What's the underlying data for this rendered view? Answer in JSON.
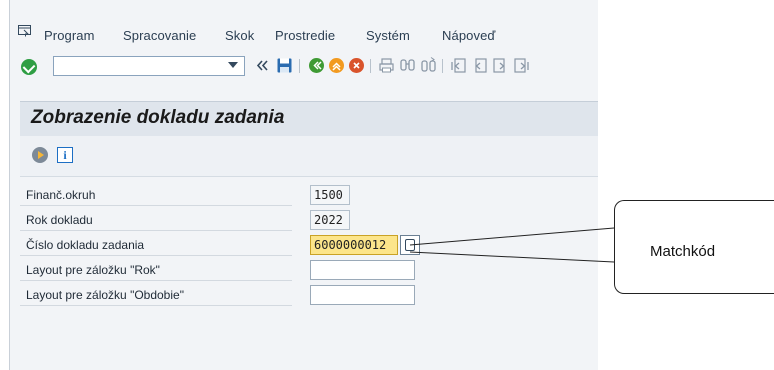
{
  "menu": {
    "items": [
      "Program",
      "Spracovanie",
      "Skok",
      "Prostredie",
      "Systém",
      "Nápoveď"
    ]
  },
  "toolbar": {
    "icons": [
      "enter-icon",
      "command-field",
      "back-icon",
      "save-icon",
      "back-green-icon",
      "exit-orange-icon",
      "cancel-red-icon",
      "print-icon",
      "find-icon",
      "find-next-icon",
      "first-page-icon",
      "previous-page-icon",
      "next-page-icon",
      "last-page-icon"
    ]
  },
  "screen": {
    "title": "Zobrazenie dokladu zadania"
  },
  "form": {
    "fields": [
      {
        "label": "Finanč.okruh",
        "value": "1500"
      },
      {
        "label": "Rok dokladu",
        "value": "2022"
      },
      {
        "label": "Číslo dokladu zadania",
        "value": "6000000012"
      },
      {
        "label": "Layout pre záložku \"Rok\"",
        "value": ""
      },
      {
        "label": "Layout pre záložku \"Obdobie\"",
        "value": ""
      }
    ]
  },
  "callout": {
    "text": "Matchkód"
  },
  "colors": {
    "focus_field": "#fce58b",
    "title_bar": "#dfe5ec",
    "menu_text": "#2b3e52"
  }
}
